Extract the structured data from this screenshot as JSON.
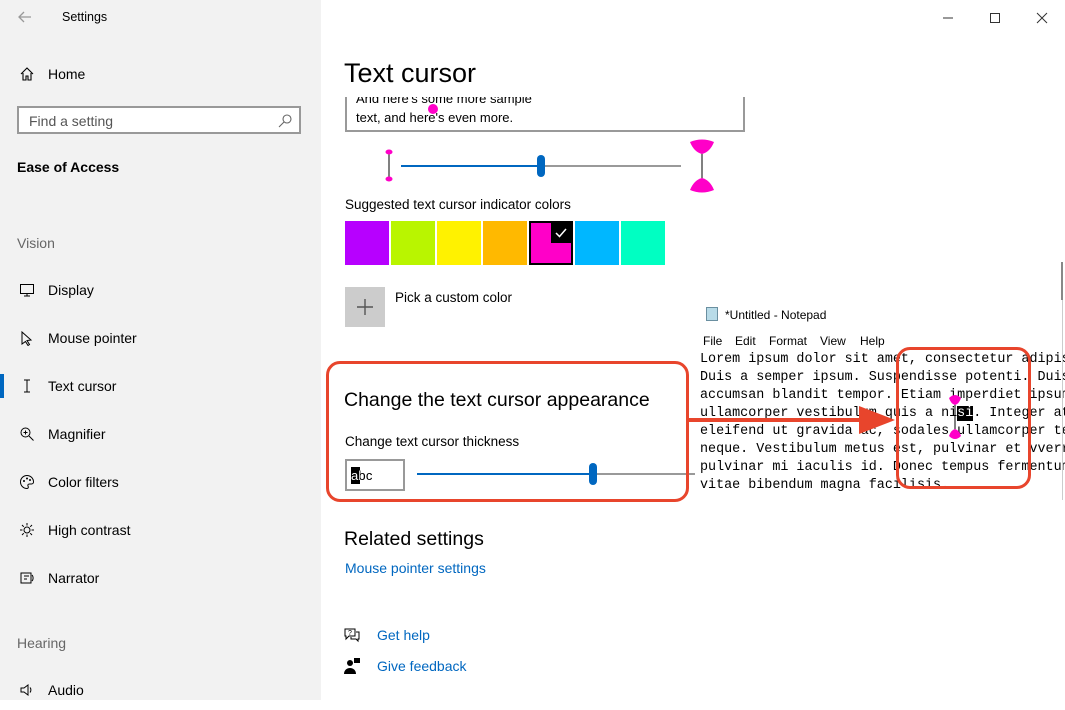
{
  "window": {
    "title": "Settings"
  },
  "sidebar": {
    "home_label": "Home",
    "search_placeholder": "Find a setting",
    "category": "Ease of Access",
    "vision_header": "Vision",
    "items": [
      {
        "label": "Display",
        "icon": "display-icon"
      },
      {
        "label": "Mouse pointer",
        "icon": "mouse-pointer-icon"
      },
      {
        "label": "Text cursor",
        "icon": "text-cursor-icon",
        "selected": true
      },
      {
        "label": "Magnifier",
        "icon": "magnifier-icon"
      },
      {
        "label": "Color filters",
        "icon": "color-filters-icon"
      },
      {
        "label": "High contrast",
        "icon": "high-contrast-icon"
      },
      {
        "label": "Narrator",
        "icon": "narrator-icon"
      }
    ],
    "hearing_header": "Hearing",
    "audio_label": "Audio"
  },
  "main": {
    "page_title": "Text cursor",
    "preview_text_line1": "And here's some more sample",
    "preview_text_line2": "text, and here's even more.",
    "indicator_size_level": 0.5,
    "suggested_colors_label": "Suggested text cursor indicator colors",
    "colors": [
      "#b700ff",
      "#b9f500",
      "#fff200",
      "#ffb900",
      "#ff00c8",
      "#00b7ff",
      "#00ffc2"
    ],
    "selected_color_index": 4,
    "custom_color_label": "Pick a custom color",
    "appearance_heading": "Change the text cursor appearance",
    "thickness_label": "Change text cursor thickness",
    "thickness_preview_text": "abc",
    "thickness_level": 0.67,
    "related_heading": "Related settings",
    "related_link": "Mouse pointer settings",
    "help_label": "Get help",
    "feedback_label": "Give feedback"
  },
  "notepad": {
    "title": "*Untitled - Notepad",
    "menu": [
      "File",
      "Edit",
      "Format",
      "View",
      "Help"
    ],
    "lines": [
      "Lorem ipsum dolor sit amet, consectetur adipis",
      "Duis a semper ipsum. Suspendisse potenti. Duis",
      "accumsan blandit tempor. Etiam imperdiet ipsum",
      "ullamcorper vestibulum quis a nisi. Integer at",
      "eleifend ut gravida ac, sodales ullamcorper te",
      "neque. Vestibulum metus est, pulvinar et vverr",
      "pulvinar mi iaculis id. Donec tempus fermentum",
      "vitae bibendum magna facilisis."
    ],
    "highlighted_text": "si"
  },
  "accent_color": "#0067c0",
  "annotation_color": "#e8452c"
}
